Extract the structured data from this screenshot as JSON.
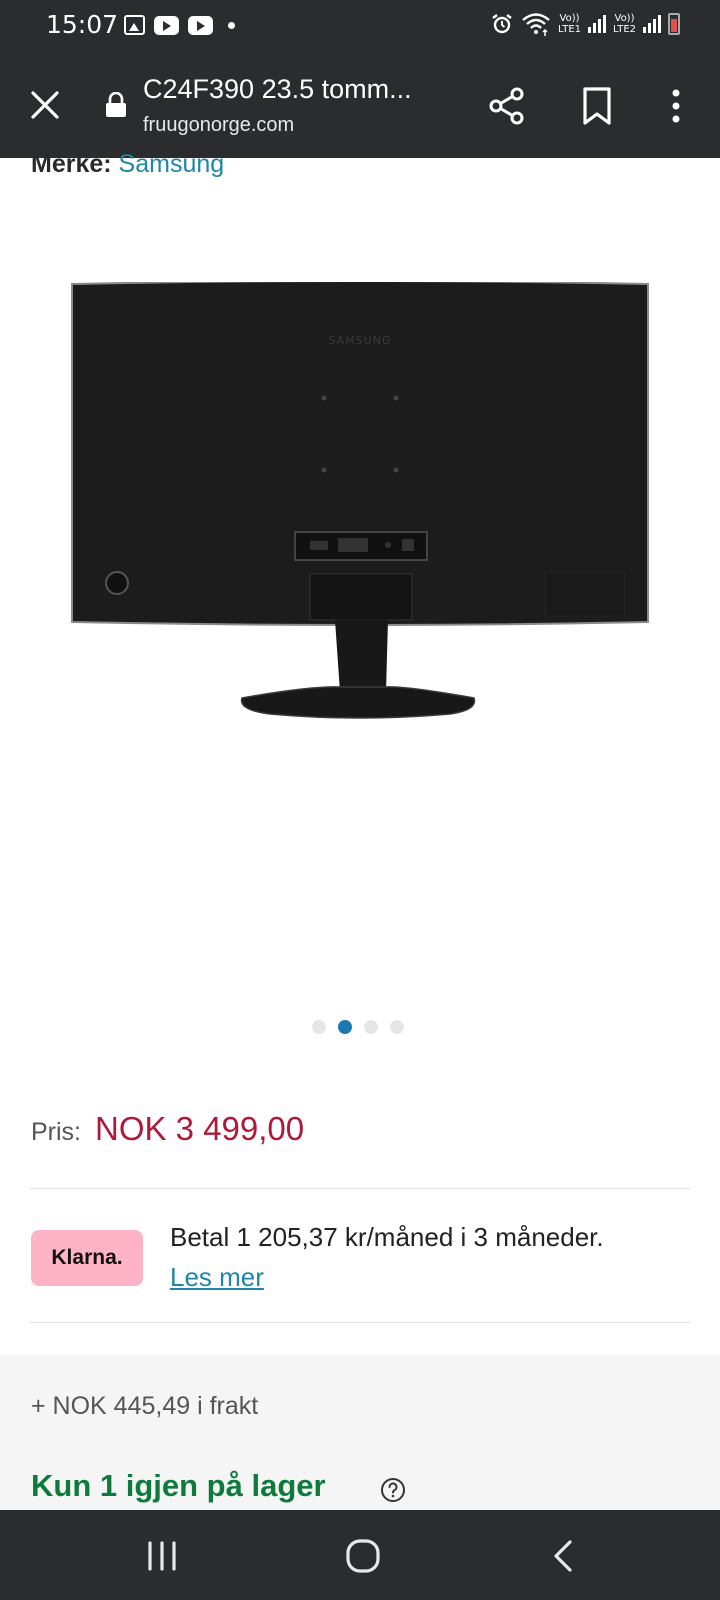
{
  "status_bar": {
    "time": "15:07",
    "sim1_label_top": "Vo))",
    "sim1_label_bottom": "LTE1",
    "sim2_label_top": "Vo))",
    "sim2_label_bottom": "LTE2"
  },
  "browser": {
    "page_title": "C24F390 23.5 tomm...",
    "url": "fruugonorge.com"
  },
  "product": {
    "brand_label": "Merke:",
    "brand_value": "Samsung",
    "image_logo_text": "SAMSUNG",
    "carousel": {
      "count": 4,
      "active_index": 1
    },
    "price_label": "Pris:",
    "price_value": "NOK 3 499,00"
  },
  "klarna": {
    "badge": "Klarna.",
    "text": "Betal 1 205,37 kr/måned i 3 måneder.",
    "link": "Les mer",
    "badge_color": "#ffb3c7"
  },
  "shipping": {
    "text": "+ NOK 445,49 i frakt"
  },
  "stock": {
    "text": "Kun 1 igjen på lager",
    "color": "#0e7a3c"
  },
  "colors": {
    "chrome": "#2b2c2e",
    "link": "#1f86a8",
    "price": "#b0183a",
    "dot_active": "#1a7ab0"
  }
}
